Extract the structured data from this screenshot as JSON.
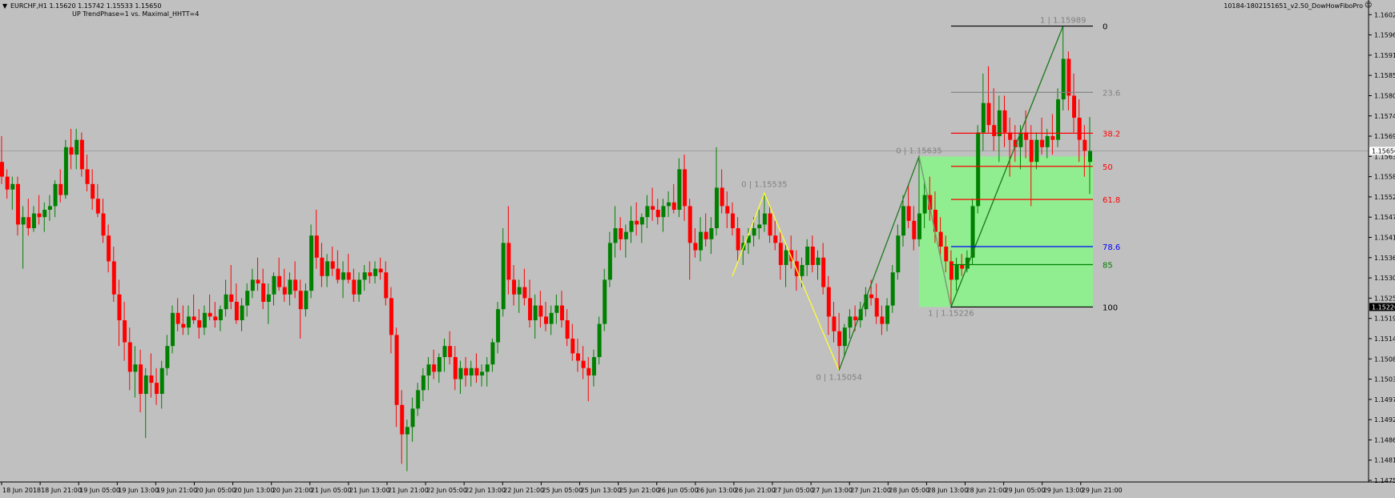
{
  "header": {
    "symbol_line": "EURCHF,H1  1.15620 1.15742 1.15533 1.15650",
    "indicator_line": "UP TrendPhase=1 vs. Maximal_HHTT=4",
    "expert_label": "10184-1802151651_v2.50_DowHowFiboPro"
  },
  "chart_data": {
    "type": "candlestick",
    "symbol": "EURCHF",
    "timeframe": "H1",
    "ohlc": {
      "open": 1.1562,
      "high": 1.15742,
      "low": 1.15533,
      "close": 1.1565
    },
    "current_price_label": "1.15650",
    "current_price": 1.1565,
    "highlight_price_label": "1.15226",
    "highlight_price": 1.15226,
    "ylim": [
      1.14755,
      1.16025
    ],
    "y_ticks": [
      "1.16020",
      "1.15965",
      "1.15910",
      "1.15855",
      "1.15800",
      "1.15745",
      "1.15690",
      "1.15635",
      "1.15580",
      "1.15525",
      "1.15470",
      "1.15415",
      "1.15360",
      "1.15305",
      "1.15250",
      "1.15195",
      "1.15140",
      "1.15085",
      "1.15030",
      "1.14975",
      "1.14920",
      "1.14865",
      "1.14810",
      "1.14755"
    ],
    "x_ticks": [
      "18 Jun 2018",
      "18 Jun 21:00",
      "19 Jun 05:00",
      "19 Jun 13:00",
      "19 Jun 21:00",
      "20 Jun 05:00",
      "20 Jun 13:00",
      "20 Jun 21:00",
      "21 Jun 05:00",
      "21 Jun 13:00",
      "21 Jun 21:00",
      "22 Jun 05:00",
      "22 Jun 13:00",
      "22 Jun 21:00",
      "25 Jun 05:00",
      "25 Jun 13:00",
      "25 Jun 21:00",
      "26 Jun 05:00",
      "26 Jun 13:00",
      "26 Jun 21:00",
      "27 Jun 05:00",
      "27 Jun 13:00",
      "27 Jun 21:00",
      "28 Jun 05:00",
      "28 Jun 13:00",
      "28 Jun 21:00",
      "29 Jun 05:00",
      "29 Jun 13:00",
      "29 Jun 21:00"
    ],
    "bull_color": "#008000",
    "bear_color": "#ff0000",
    "pivots": [
      {
        "label": "0 | 1.15535",
        "price": 1.15535
      },
      {
        "label": "0 | 1.15054",
        "price": 1.15054
      },
      {
        "label": "0 | 1.15635",
        "price": 1.15635
      },
      {
        "label": "1 | 1.15226",
        "price": 1.15226
      },
      {
        "label": "1 | 1.15989",
        "price": 1.15989
      }
    ],
    "fibo_levels": [
      {
        "label": "0",
        "price": 1.15989,
        "color": "#000000"
      },
      {
        "label": "23.6",
        "price": 1.15809,
        "color": "#808080"
      },
      {
        "label": "38.2",
        "price": 1.15698,
        "color": "#ff0000"
      },
      {
        "label": "50",
        "price": 1.15608,
        "color": "#ff0000"
      },
      {
        "label": "61.8",
        "price": 1.15518,
        "color": "#ff0000"
      },
      {
        "label": "78.6",
        "price": 1.1539,
        "color": "#0000ff"
      },
      {
        "label": "85",
        "price": 1.15341,
        "color": "#008000"
      },
      {
        "label": "100",
        "price": 1.15226,
        "color": "#000000"
      }
    ],
    "zone_color": "#90ee90",
    "zigzag_colors": {
      "yellow": "#ffff33",
      "green": "#1e7a1e"
    },
    "candles": [
      [
        1.1562,
        1.1569,
        1.1556,
        1.1558
      ],
      [
        1.1558,
        1.156,
        1.1552,
        1.15545
      ],
      [
        1.15545,
        1.1558,
        1.1549,
        1.1556
      ],
      [
        1.1556,
        1.1558,
        1.1542,
        1.1545
      ],
      [
        1.1545,
        1.155,
        1.1533,
        1.1547
      ],
      [
        1.1547,
        1.1552,
        1.1542,
        1.1544
      ],
      [
        1.1544,
        1.155,
        1.1543,
        1.1548
      ],
      [
        1.1548,
        1.1553,
        1.1545,
        1.1547
      ],
      [
        1.1547,
        1.1551,
        1.1543,
        1.1549
      ],
      [
        1.1549,
        1.1553,
        1.1546,
        1.155
      ],
      [
        1.155,
        1.1557,
        1.1547,
        1.1556
      ],
      [
        1.1556,
        1.156,
        1.1551,
        1.1553
      ],
      [
        1.1553,
        1.1568,
        1.1552,
        1.1566
      ],
      [
        1.1566,
        1.1571,
        1.156,
        1.1564
      ],
      [
        1.1564,
        1.1571,
        1.156,
        1.1568
      ],
      [
        1.1568,
        1.157,
        1.1558,
        1.156
      ],
      [
        1.156,
        1.1564,
        1.1554,
        1.1556
      ],
      [
        1.1556,
        1.156,
        1.1549,
        1.1552
      ],
      [
        1.1552,
        1.1556,
        1.1547,
        1.1548
      ],
      [
        1.1548,
        1.1552,
        1.154,
        1.1542
      ],
      [
        1.1542,
        1.1545,
        1.1532,
        1.1535
      ],
      [
        1.1535,
        1.1539,
        1.1524,
        1.1526
      ],
      [
        1.1526,
        1.153,
        1.1512,
        1.1519
      ],
      [
        1.1519,
        1.1524,
        1.1508,
        1.1513
      ],
      [
        1.1513,
        1.1517,
        1.15,
        1.1505
      ],
      [
        1.1505,
        1.1512,
        1.1498,
        1.1507
      ],
      [
        1.1507,
        1.1511,
        1.1494,
        1.1499
      ],
      [
        1.1499,
        1.1506,
        1.1487,
        1.1504
      ],
      [
        1.1504,
        1.151,
        1.1498,
        1.1502
      ],
      [
        1.1502,
        1.1506,
        1.1496,
        1.1499
      ],
      [
        1.1499,
        1.1508,
        1.1495,
        1.1506
      ],
      [
        1.1506,
        1.1515,
        1.1504,
        1.1512
      ],
      [
        1.1512,
        1.1523,
        1.151,
        1.1521
      ],
      [
        1.1521,
        1.1525,
        1.1516,
        1.1518
      ],
      [
        1.1518,
        1.1523,
        1.1515,
        1.1517
      ],
      [
        1.1517,
        1.1523,
        1.1515,
        1.152
      ],
      [
        1.152,
        1.1526,
        1.1518,
        1.1519
      ],
      [
        1.1519,
        1.1522,
        1.1514,
        1.1517
      ],
      [
        1.1517,
        1.1523,
        1.1515,
        1.1521
      ],
      [
        1.1521,
        1.1526,
        1.1519,
        1.152
      ],
      [
        1.152,
        1.1524,
        1.1517,
        1.1519
      ],
      [
        1.1519,
        1.1523,
        1.1516,
        1.1522
      ],
      [
        1.1522,
        1.153,
        1.152,
        1.1526
      ],
      [
        1.1526,
        1.1534,
        1.1522,
        1.1524
      ],
      [
        1.1524,
        1.1529,
        1.1518,
        1.1519
      ],
      [
        1.1519,
        1.1525,
        1.1516,
        1.1523
      ],
      [
        1.1523,
        1.1529,
        1.152,
        1.1527
      ],
      [
        1.1527,
        1.1533,
        1.1525,
        1.153
      ],
      [
        1.153,
        1.1536,
        1.1527,
        1.1529
      ],
      [
        1.1529,
        1.1533,
        1.1522,
        1.1524
      ],
      [
        1.1524,
        1.1529,
        1.1518,
        1.1526
      ],
      [
        1.1526,
        1.1532,
        1.1523,
        1.1531
      ],
      [
        1.1531,
        1.1536,
        1.1527,
        1.1528
      ],
      [
        1.1528,
        1.1533,
        1.1524,
        1.1526
      ],
      [
        1.1526,
        1.1532,
        1.1523,
        1.153
      ],
      [
        1.153,
        1.1535,
        1.1525,
        1.1527
      ],
      [
        1.1527,
        1.153,
        1.1514,
        1.1522
      ],
      [
        1.1522,
        1.1529,
        1.152,
        1.1527
      ],
      [
        1.1527,
        1.1545,
        1.1525,
        1.1542
      ],
      [
        1.1542,
        1.1549,
        1.1533,
        1.1536
      ],
      [
        1.1536,
        1.154,
        1.1528,
        1.1531
      ],
      [
        1.1531,
        1.1537,
        1.1528,
        1.1535
      ],
      [
        1.1535,
        1.1539,
        1.1531,
        1.1533
      ],
      [
        1.1533,
        1.1538,
        1.1529,
        1.153
      ],
      [
        1.153,
        1.1535,
        1.1525,
        1.1532
      ],
      [
        1.1532,
        1.1537,
        1.1529,
        1.153
      ],
      [
        1.153,
        1.1533,
        1.1524,
        1.1526
      ],
      [
        1.1526,
        1.1532,
        1.1524,
        1.153
      ],
      [
        1.153,
        1.1534,
        1.1527,
        1.1532
      ],
      [
        1.1532,
        1.1535,
        1.1529,
        1.1531
      ],
      [
        1.1531,
        1.1535,
        1.1529,
        1.1533
      ],
      [
        1.1533,
        1.1536,
        1.153,
        1.1532
      ],
      [
        1.1532,
        1.1535,
        1.1523,
        1.1525
      ],
      [
        1.1525,
        1.1528,
        1.151,
        1.1515
      ],
      [
        1.1515,
        1.1517,
        1.149,
        1.1496
      ],
      [
        1.1496,
        1.15,
        1.148,
        1.1488
      ],
      [
        1.1488,
        1.1492,
        1.1478,
        1.149
      ],
      [
        1.149,
        1.1498,
        1.1486,
        1.1495
      ],
      [
        1.1495,
        1.1502,
        1.1493,
        1.15
      ],
      [
        1.15,
        1.1506,
        1.1497,
        1.1504
      ],
      [
        1.1504,
        1.1509,
        1.15,
        1.1507
      ],
      [
        1.1507,
        1.1511,
        1.1503,
        1.1505
      ],
      [
        1.1505,
        1.151,
        1.1502,
        1.1509
      ],
      [
        1.1509,
        1.1514,
        1.1505,
        1.1512
      ],
      [
        1.1512,
        1.1516,
        1.1507,
        1.1509
      ],
      [
        1.1509,
        1.1512,
        1.15,
        1.1503
      ],
      [
        1.1503,
        1.1508,
        1.1499,
        1.1506
      ],
      [
        1.1506,
        1.1509,
        1.1501,
        1.1504
      ],
      [
        1.1504,
        1.1508,
        1.1501,
        1.1506
      ],
      [
        1.1506,
        1.151,
        1.1502,
        1.1504
      ],
      [
        1.1504,
        1.1507,
        1.1501,
        1.1505
      ],
      [
        1.1505,
        1.1509,
        1.1501,
        1.1507
      ],
      [
        1.1507,
        1.1514,
        1.1505,
        1.1513
      ],
      [
        1.1513,
        1.1524,
        1.151,
        1.1522
      ],
      [
        1.1522,
        1.1544,
        1.152,
        1.154
      ],
      [
        1.154,
        1.155,
        1.1526,
        1.153
      ],
      [
        1.153,
        1.1534,
        1.1523,
        1.1526
      ],
      [
        1.1526,
        1.153,
        1.1521,
        1.1528
      ],
      [
        1.1528,
        1.1533,
        1.1523,
        1.1525
      ],
      [
        1.1525,
        1.153,
        1.1517,
        1.1519
      ],
      [
        1.1519,
        1.1526,
        1.1514,
        1.1523
      ],
      [
        1.1523,
        1.1527,
        1.1517,
        1.152
      ],
      [
        1.152,
        1.1524,
        1.1516,
        1.1518
      ],
      [
        1.1518,
        1.1523,
        1.1515,
        1.1521
      ],
      [
        1.1521,
        1.1526,
        1.1518,
        1.1523
      ],
      [
        1.1523,
        1.1527,
        1.1517,
        1.1519
      ],
      [
        1.1519,
        1.1522,
        1.1512,
        1.1514
      ],
      [
        1.1514,
        1.1518,
        1.1508,
        1.151
      ],
      [
        1.151,
        1.1514,
        1.1505,
        1.1508
      ],
      [
        1.1508,
        1.1512,
        1.1503,
        1.1506
      ],
      [
        1.1506,
        1.1509,
        1.1497,
        1.1504
      ],
      [
        1.1504,
        1.1511,
        1.1501,
        1.1509
      ],
      [
        1.1509,
        1.152,
        1.1507,
        1.1518
      ],
      [
        1.1518,
        1.1533,
        1.1516,
        1.153
      ],
      [
        1.153,
        1.1543,
        1.1528,
        1.154
      ],
      [
        1.154,
        1.155,
        1.1536,
        1.1544
      ],
      [
        1.1544,
        1.1547,
        1.1538,
        1.1541
      ],
      [
        1.1541,
        1.1545,
        1.1536,
        1.1543
      ],
      [
        1.1543,
        1.155,
        1.154,
        1.1546
      ],
      [
        1.1546,
        1.1551,
        1.1542,
        1.1545
      ],
      [
        1.1545,
        1.1548,
        1.154,
        1.1547
      ],
      [
        1.1547,
        1.1553,
        1.1544,
        1.155
      ],
      [
        1.155,
        1.1555,
        1.1546,
        1.1549
      ],
      [
        1.1549,
        1.1552,
        1.1545,
        1.1547
      ],
      [
        1.1547,
        1.1552,
        1.1543,
        1.155
      ],
      [
        1.155,
        1.1554,
        1.1547,
        1.1551
      ],
      [
        1.1551,
        1.1556,
        1.1548,
        1.1549
      ],
      [
        1.1549,
        1.1563,
        1.1547,
        1.156
      ],
      [
        1.156,
        1.1564,
        1.1546,
        1.155
      ],
      [
        1.155,
        1.1552,
        1.153,
        1.154
      ],
      [
        1.154,
        1.1544,
        1.1536,
        1.1538
      ],
      [
        1.1538,
        1.1547,
        1.1535,
        1.1543
      ],
      [
        1.1543,
        1.1548,
        1.1539,
        1.1541
      ],
      [
        1.1541,
        1.1547,
        1.1537,
        1.1544
      ],
      [
        1.1544,
        1.1566,
        1.1542,
        1.1555
      ],
      [
        1.1555,
        1.156,
        1.1548,
        1.155
      ],
      [
        1.155,
        1.1554,
        1.1544,
        1.1548
      ],
      [
        1.1548,
        1.1551,
        1.1542,
        1.1544
      ],
      [
        1.1544,
        1.1547,
        1.1535,
        1.1538
      ],
      [
        1.1538,
        1.1542,
        1.1534,
        1.154
      ],
      [
        1.154,
        1.1544,
        1.1537,
        1.1542
      ],
      [
        1.1542,
        1.1547,
        1.1539,
        1.1544
      ],
      [
        1.1544,
        1.1549,
        1.1541,
        1.1545
      ],
      [
        1.1545,
        1.15535,
        1.1543,
        1.1548
      ],
      [
        1.1548,
        1.155,
        1.154,
        1.1542
      ],
      [
        1.1542,
        1.1546,
        1.1538,
        1.154
      ],
      [
        1.154,
        1.1543,
        1.153,
        1.1534
      ],
      [
        1.1534,
        1.154,
        1.1528,
        1.1538
      ],
      [
        1.1538,
        1.1542,
        1.1533,
        1.1535
      ],
      [
        1.1535,
        1.1538,
        1.1527,
        1.1531
      ],
      [
        1.1531,
        1.1536,
        1.1528,
        1.1534
      ],
      [
        1.1534,
        1.1541,
        1.1531,
        1.1539
      ],
      [
        1.1539,
        1.1542,
        1.1532,
        1.1534
      ],
      [
        1.1534,
        1.1538,
        1.153,
        1.1536
      ],
      [
        1.1536,
        1.154,
        1.1526,
        1.1528
      ],
      [
        1.1528,
        1.1531,
        1.1515,
        1.152
      ],
      [
        1.152,
        1.1524,
        1.1513,
        1.1516
      ],
      [
        1.1516,
        1.1521,
        1.15054,
        1.1512
      ],
      [
        1.1512,
        1.1518,
        1.1509,
        1.1517
      ],
      [
        1.1517,
        1.1522,
        1.1514,
        1.152
      ],
      [
        1.152,
        1.1523,
        1.1516,
        1.1519
      ],
      [
        1.1519,
        1.1524,
        1.1517,
        1.1522
      ],
      [
        1.1522,
        1.1528,
        1.152,
        1.1526
      ],
      [
        1.1526,
        1.153,
        1.1523,
        1.1525
      ],
      [
        1.1525,
        1.1529,
        1.1518,
        1.152
      ],
      [
        1.152,
        1.1523,
        1.1515,
        1.1518
      ],
      [
        1.1518,
        1.1525,
        1.1516,
        1.1523
      ],
      [
        1.1523,
        1.1534,
        1.1521,
        1.1532
      ],
      [
        1.1532,
        1.1545,
        1.153,
        1.1542
      ],
      [
        1.1542,
        1.1553,
        1.1539,
        1.155
      ],
      [
        1.155,
        1.1556,
        1.1544,
        1.1546
      ],
      [
        1.1546,
        1.155,
        1.1538,
        1.1541
      ],
      [
        1.1541,
        1.15635,
        1.1539,
        1.1548
      ],
      [
        1.1548,
        1.1557,
        1.1544,
        1.1553
      ],
      [
        1.1553,
        1.1558,
        1.1546,
        1.1549
      ],
      [
        1.1549,
        1.1554,
        1.154,
        1.1543
      ],
      [
        1.1543,
        1.1547,
        1.1536,
        1.1539
      ],
      [
        1.1539,
        1.1542,
        1.1532,
        1.1535
      ],
      [
        1.1535,
        1.1538,
        1.15226,
        1.153
      ],
      [
        1.153,
        1.1536,
        1.1527,
        1.1534
      ],
      [
        1.1534,
        1.1537,
        1.1531,
        1.1533
      ],
      [
        1.1533,
        1.1538,
        1.1532,
        1.1536
      ],
      [
        1.1536,
        1.1552,
        1.1534,
        1.155
      ],
      [
        1.155,
        1.1572,
        1.1548,
        1.157
      ],
      [
        1.157,
        1.1586,
        1.1565,
        1.1578
      ],
      [
        1.1578,
        1.1588,
        1.157,
        1.1572
      ],
      [
        1.1572,
        1.1582,
        1.1565,
        1.1569
      ],
      [
        1.1569,
        1.158,
        1.1562,
        1.1576
      ],
      [
        1.1576,
        1.158,
        1.1566,
        1.157
      ],
      [
        1.157,
        1.1574,
        1.1558,
        1.1568
      ],
      [
        1.1568,
        1.1572,
        1.1562,
        1.1566
      ],
      [
        1.1566,
        1.1572,
        1.156,
        1.157
      ],
      [
        1.157,
        1.1576,
        1.1563,
        1.1568
      ],
      [
        1.1568,
        1.1572,
        1.155,
        1.1562
      ],
      [
        1.1562,
        1.157,
        1.156,
        1.1568
      ],
      [
        1.1568,
        1.1574,
        1.1564,
        1.1566
      ],
      [
        1.1566,
        1.1571,
        1.1563,
        1.1569
      ],
      [
        1.1569,
        1.1575,
        1.1564,
        1.1568
      ],
      [
        1.1568,
        1.1582,
        1.1566,
        1.1579
      ],
      [
        1.1579,
        1.15989,
        1.1576,
        1.159
      ],
      [
        1.159,
        1.1592,
        1.1576,
        1.158
      ],
      [
        1.158,
        1.1586,
        1.157,
        1.1574
      ],
      [
        1.1574,
        1.1579,
        1.1562,
        1.1568
      ],
      [
        1.1568,
        1.1572,
        1.1558,
        1.1565
      ],
      [
        1.1562,
        1.15742,
        1.15533,
        1.1565
      ]
    ]
  }
}
